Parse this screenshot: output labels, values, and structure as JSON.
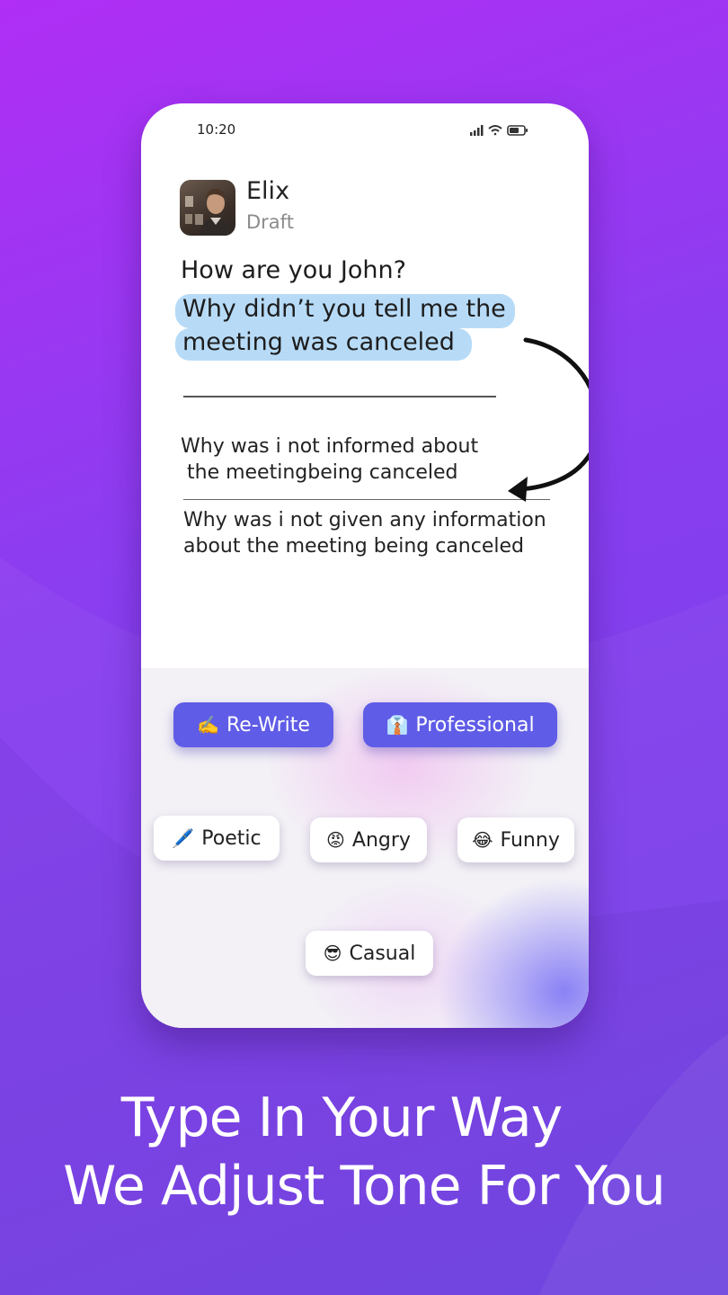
{
  "status_bar": {
    "time": "10:20"
  },
  "contact": {
    "name": "Elix",
    "status": "Draft"
  },
  "message": {
    "greeting": "How are you John?",
    "highlighted_line_1": "Why didn’t you tell me the",
    "highlighted_line_2": "meeting was canceled"
  },
  "suggestions": [
    {
      "line1": "Why was i not informed about",
      "line2": " the meetingbeing canceled"
    },
    {
      "line1": "Why was i not given any information",
      "line2": "about the meeting being canceled"
    }
  ],
  "tones": {
    "rewrite": {
      "emoji": "✍️",
      "label": "Re-Write"
    },
    "professional": {
      "emoji": "👔",
      "label": "Professional"
    },
    "poetic": {
      "emoji": "🖊️",
      "label": "Poetic"
    },
    "angry": {
      "emoji": "😡",
      "label": "Angry"
    },
    "funny": {
      "emoji": "😂",
      "label": "Funny"
    },
    "casual": {
      "emoji": "😎",
      "label": "Casual"
    }
  },
  "headline": {
    "line1": "Type In Your Way",
    "line2": "We Adjust Tone For You"
  },
  "colors": {
    "background_top": "#b02ef5",
    "background_bottom": "#6f43e4",
    "primary_button": "#5f5ce7",
    "highlight": "#b7dbf7"
  },
  "icons": [
    "signal-icon",
    "wifi-icon",
    "battery-icon",
    "curved-arrow-icon"
  ]
}
